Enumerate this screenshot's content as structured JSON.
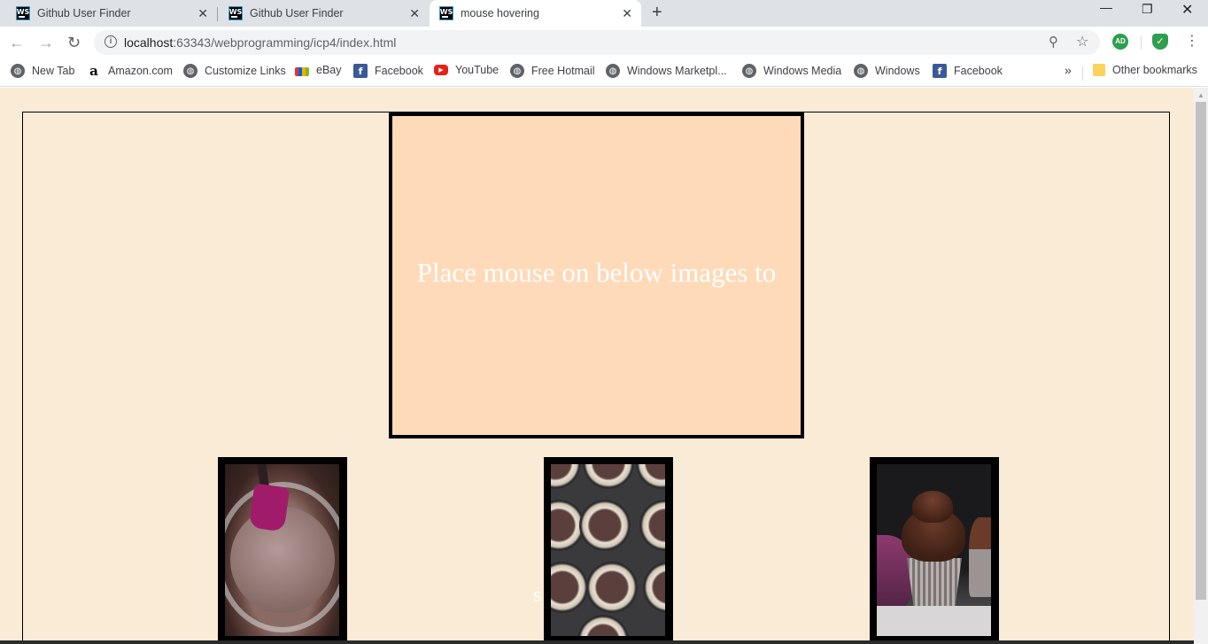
{
  "browser": {
    "tabs": [
      {
        "title": "Github User Finder",
        "icon": "webstorm-icon",
        "active": false
      },
      {
        "title": "Github User Finder",
        "icon": "webstorm-icon",
        "active": false
      },
      {
        "title": "mouse hovering",
        "icon": "webstorm-icon",
        "active": true
      }
    ],
    "favicon_text": "WS",
    "url_host": "localhost",
    "url_path": ":63343/webprogramming/icp4/index.html",
    "profile_initials": "AD",
    "bookmarks": [
      {
        "label": "New Tab",
        "icon": "globe-icon"
      },
      {
        "label": "Amazon.com",
        "icon": "amazon-icon"
      },
      {
        "label": "Customize Links",
        "icon": "globe-icon"
      },
      {
        "label": "eBay",
        "icon": "ebay-icon"
      },
      {
        "label": "Facebook",
        "icon": "facebook-icon"
      },
      {
        "label": "YouTube",
        "icon": "youtube-icon"
      },
      {
        "label": "Free Hotmail",
        "icon": "globe-icon"
      },
      {
        "label": "Windows Marketpl...",
        "icon": "globe-icon"
      },
      {
        "label": "Windows Media",
        "icon": "globe-icon"
      },
      {
        "label": "Windows",
        "icon": "globe-icon"
      },
      {
        "label": "Facebook",
        "icon": "facebook-icon"
      }
    ],
    "more_bookmarks": "»",
    "other_bookmarks": "Other bookmarks"
  },
  "page": {
    "preview_text": "Place mouse on below images to",
    "stray_text": "s",
    "background_color": "#faebd7",
    "preview_color": "#ffdab9"
  }
}
